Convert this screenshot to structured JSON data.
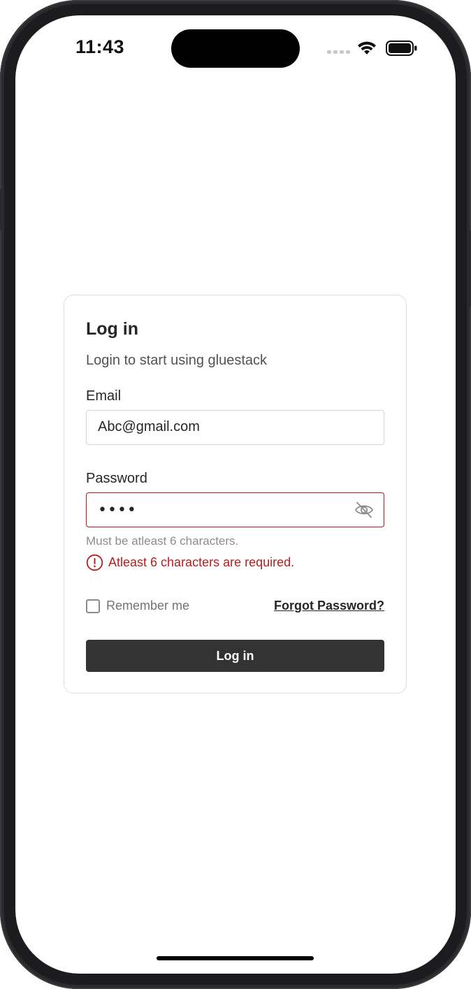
{
  "status_bar": {
    "time": "11:43",
    "icons": [
      "signal-icon",
      "wifi-icon",
      "battery-icon"
    ]
  },
  "login_card": {
    "title": "Log in",
    "subtitle": "Login to start using gluestack",
    "email": {
      "label": "Email",
      "value": "Abc@gmail.com",
      "placeholder": ""
    },
    "password": {
      "label": "Password",
      "masked_value": "••••",
      "helper": "Must be atleast 6 characters.",
      "error": "Atleast 6 characters are required.",
      "toggle_icon": "eye-off-icon"
    },
    "remember_me": {
      "label": "Remember me",
      "checked": false
    },
    "forgot_password": "Forgot Password?",
    "submit": "Log in"
  },
  "colors": {
    "error": "#b91c1c",
    "primary_button": "#333333",
    "text": "#262626",
    "border": "#d4d4d4"
  }
}
